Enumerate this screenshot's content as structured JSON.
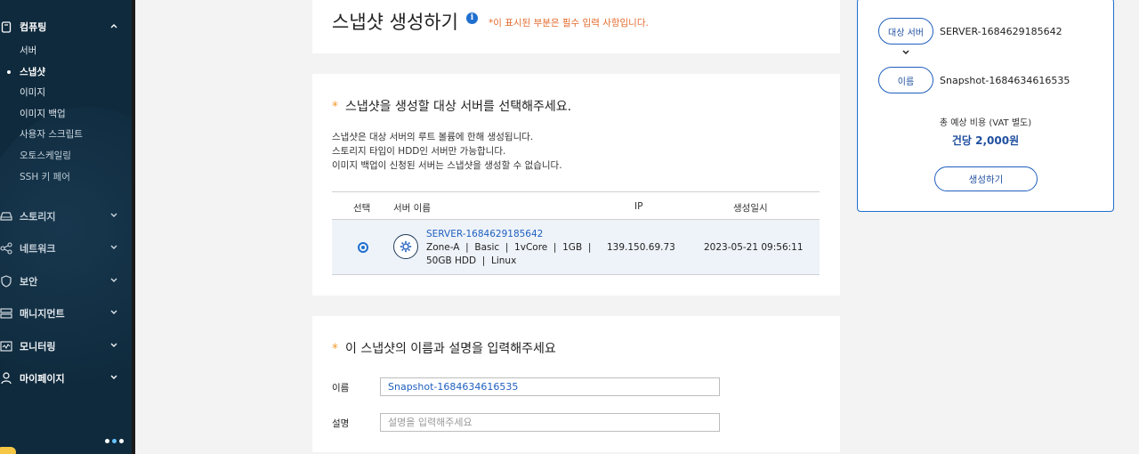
{
  "sidebar": {
    "groups": [
      {
        "label": "컴퓨팅",
        "icon": "server-icon"
      },
      {
        "label": "스토리지",
        "icon": "storage-icon"
      },
      {
        "label": "네트워크",
        "icon": "network-icon"
      },
      {
        "label": "보안",
        "icon": "shield-icon"
      },
      {
        "label": "매니지먼트",
        "icon": "management-icon"
      },
      {
        "label": "모니터링",
        "icon": "monitor-icon"
      },
      {
        "label": "마이페이지",
        "icon": "user-icon"
      }
    ],
    "computing_items": [
      {
        "label": "서버"
      },
      {
        "label": "스냅샷",
        "active": true
      },
      {
        "label": "이미지"
      },
      {
        "label": "이미지 백업"
      },
      {
        "label": "사용자 스크립트"
      },
      {
        "label": "오토스케일링"
      },
      {
        "label": "SSH 키 페어"
      }
    ]
  },
  "header": {
    "title": "스냅샷 생성하기",
    "info_icon": "i",
    "required_note": "*이 표시된 부분은 필수 입력 사항입니다."
  },
  "server_section": {
    "star": "*",
    "title": "스냅샷을 생성할 대상 서버를 선택해주세요.",
    "descriptions": [
      "스냅샷은 대상 서버의 루트 볼륨에 한해 생성됩니다.",
      "스토리지 타입이 HDD인 서버만 가능합니다.",
      "이미지 백업이 신청된 서버는 스냅샷을 생성할 수 없습니다."
    ],
    "table": {
      "columns": [
        "선택",
        "서버 이름",
        "IP",
        "생성일시"
      ],
      "rows": [
        {
          "selected": true,
          "name": "SERVER-1684629185642",
          "spec_line1": "Zone-A  |  Basic  |  1vCore  |  1GB  |",
          "spec_line2": "50GB HDD  |  Linux",
          "ip": "139.150.69.73",
          "created": "2023-05-21 09:56:11"
        }
      ]
    }
  },
  "name_section": {
    "star": "*",
    "title": "이 스냅샷의 이름과 설명을 입력해주세요",
    "name_label": "이름",
    "name_value": "Snapshot-1684634616535",
    "desc_label": "설명",
    "desc_placeholder": "설명을 입력해주세요"
  },
  "summary": {
    "target_label": "대상 서버",
    "target_value": "SERVER-1684629185642",
    "name_label": "이름",
    "name_value": "Snapshot-1684634616535",
    "cost_label": "총 예상 비용 (VAT 별도)",
    "cost_value": "건당 2,000원",
    "create_button": "생성하기"
  },
  "colors": {
    "sidebar_bg": "#0f2a3d",
    "accent": "#1f6fcf",
    "required": "#e46b2d"
  }
}
